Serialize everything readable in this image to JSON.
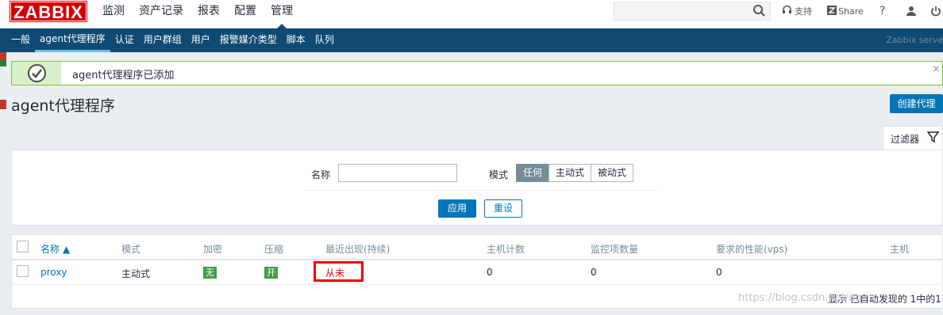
{
  "topbar": {
    "logo": "ZABBIX",
    "menu": [
      "监测",
      "资产记录",
      "报表",
      "配置",
      "管理"
    ],
    "active_menu_index": 4,
    "search": {
      "value": "",
      "placeholder": ""
    },
    "support_label": "支持",
    "share_label": "Share",
    "help_label": "?"
  },
  "subnav": {
    "items": [
      "一般",
      "agent代理程序",
      "认证",
      "用户群组",
      "用户",
      "报警媒介类型",
      "脚本",
      "队列"
    ],
    "active_index": 1,
    "server_label": "Zabbix serve"
  },
  "message": {
    "text": "agent代理程序已添加",
    "close": "×"
  },
  "page": {
    "title": "agent代理程序",
    "create_button": "创建代理"
  },
  "filter": {
    "tab_label": "过滤器",
    "name_label": "名称",
    "name_value": "",
    "mode_label": "模式",
    "mode_options": [
      "任何",
      "主动式",
      "被动式"
    ],
    "mode_selected_index": 0,
    "apply": "应用",
    "reset": "重设"
  },
  "table": {
    "headers": {
      "name": "名称 ▲",
      "mode": "模式",
      "encryption": "加密",
      "compression": "压缩",
      "last_seen": "最近出现(持续)",
      "host_count": "主机计数",
      "item_count": "监控项数量",
      "vps": "要求的性能(vps)",
      "hosts": "主机"
    },
    "rows": [
      {
        "name": "proxy",
        "mode": "主动式",
        "encryption": "无",
        "compression": "开",
        "last_seen": "从未",
        "host_count": "0",
        "item_count": "0",
        "vps": "0"
      }
    ],
    "footer": "显示 已自动发现的 1中的1"
  },
  "watermark": "https://blog.csdn.net/qq_..."
}
